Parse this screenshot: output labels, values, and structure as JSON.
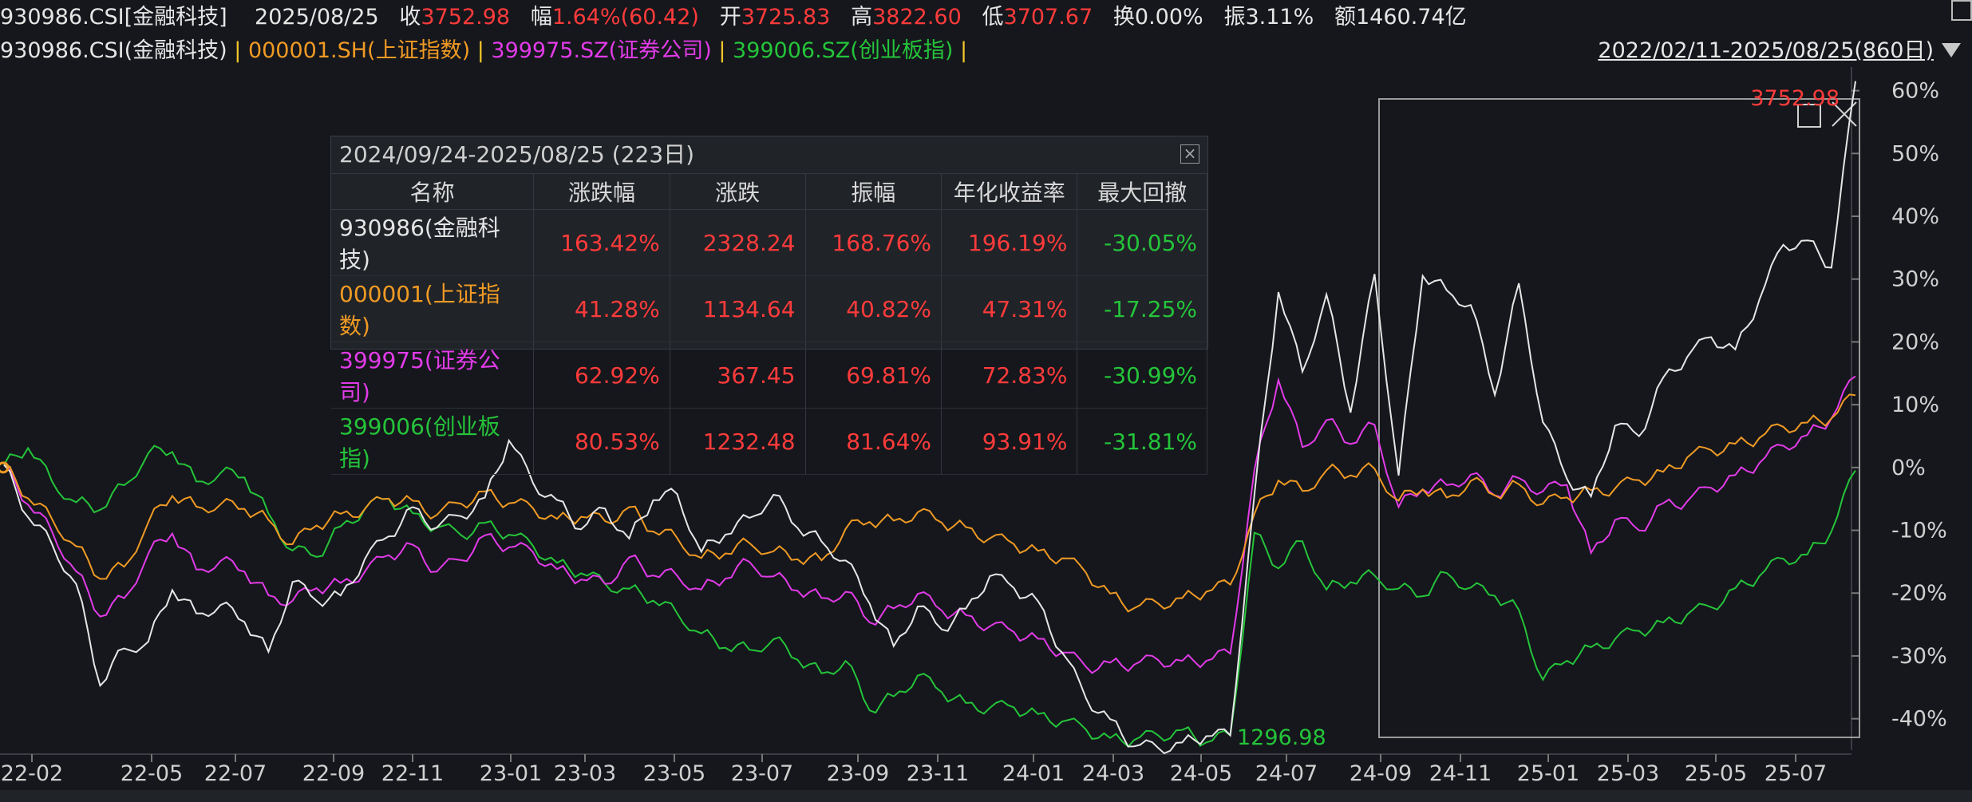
{
  "header": {
    "code": "930986.CSI[金融科技]",
    "date": "2025/08/25",
    "close_label": "收",
    "close": "3752.98",
    "change_label": "幅",
    "change": "1.64%(60.42)",
    "open_label": "开",
    "open": "3725.83",
    "high_label": "高",
    "high": "3822.60",
    "low_label": "低",
    "low": "3707.67",
    "turnover_label": "换",
    "turnover": "0.00%",
    "amplitude_label": "振",
    "amplitude": "3.11%",
    "amount_label": "额",
    "amount": "1460.74亿"
  },
  "legend": {
    "items": [
      {
        "label": "930986.CSI(金融科技)",
        "color": "#e6e6e6"
      },
      {
        "label": "000001.SH(上证指数)",
        "color": "#f09a24"
      },
      {
        "label": "399975.SZ(证券公司)",
        "color": "#e23be8"
      },
      {
        "label": "399006.SZ(创业板指)",
        "color": "#25c43a"
      }
    ],
    "range": "2022/02/11-2025/08/25(860日)"
  },
  "stats_panel": {
    "title": "2024/09/24-2025/08/25 (223日)",
    "columns": [
      "名称",
      "涨跌幅",
      "涨跌",
      "振幅",
      "年化收益率",
      "最大回撤"
    ],
    "rows": [
      {
        "name": "930986(金融科技)",
        "color": "#e6e6e6",
        "values": [
          "163.42%",
          "2328.24",
          "168.76%",
          "196.19%",
          "-30.05%"
        ]
      },
      {
        "name": "000001(上证指数)",
        "color": "#f09a24",
        "values": [
          "41.28%",
          "1134.64",
          "40.82%",
          "47.31%",
          "-17.25%"
        ]
      },
      {
        "name": "399975(证券公司)",
        "color": "#e23be8",
        "values": [
          "62.92%",
          "367.45",
          "69.81%",
          "72.83%",
          "-30.99%"
        ]
      },
      {
        "name": "399006(创业板指)",
        "color": "#25c43a",
        "values": [
          "80.53%",
          "1232.48",
          "81.64%",
          "93.91%",
          "-31.81%"
        ]
      }
    ]
  },
  "chart_data": {
    "type": "line",
    "xlabel": "",
    "ylabel": "",
    "ylim": [
      -45,
      63
    ],
    "y_ticks": [
      "60%",
      "50%",
      "40%",
      "30%",
      "20%",
      "10%",
      "0%",
      "-10%",
      "-20%",
      "-30%",
      "-40%"
    ],
    "x_ticks": [
      "22-02",
      "22-05",
      "22-07",
      "22-09",
      "22-11",
      "23-01",
      "23-03",
      "23-05",
      "23-07",
      "23-09",
      "23-11",
      "24-01",
      "24-03",
      "24-05",
      "24-07",
      "24-09",
      "24-11",
      "25-01",
      "25-03",
      "25-05",
      "25-07"
    ],
    "annotations": {
      "max_label": "3752.98",
      "min_label": "1296.98"
    },
    "grid": false,
    "series": [
      {
        "name": "930986.CSI(金融科技)",
        "color": "#e6e6e6",
        "values": [
          0,
          -8,
          -12,
          -18,
          -34,
          -28,
          -27,
          -19,
          -23,
          -22,
          -25,
          -30,
          -19,
          -22,
          -21,
          -15,
          -11,
          -6,
          -9,
          -7,
          -4,
          5,
          -2,
          -5,
          -10,
          -7,
          -12,
          -6,
          -5,
          -14,
          -11,
          -8,
          -4,
          -9,
          -11,
          -14,
          -21,
          -28,
          -22,
          -26,
          -23,
          -18,
          -20,
          -22,
          -30,
          -37,
          -40,
          -44,
          -44,
          -43,
          -42,
          -42,
          -4,
          28,
          15,
          27,
          8,
          30,
          -2,
          30,
          28,
          26,
          12,
          30,
          8,
          -1,
          -4,
          7,
          5,
          14,
          17,
          20,
          18,
          26,
          35,
          36,
          32,
          62
        ]
      },
      {
        "name": "000001.SH(上证指数)",
        "color": "#f09a24",
        "values": [
          0,
          -5,
          -8,
          -12,
          -17,
          -15,
          -8,
          -4,
          -6,
          -6,
          -7,
          -9,
          -13,
          -10,
          -8,
          -7,
          -5,
          -5,
          -7,
          -5,
          -3,
          -5,
          -6,
          -8,
          -8,
          -9,
          -7,
          -11,
          -12,
          -15,
          -14,
          -12,
          -13,
          -14,
          -14,
          -9,
          -8,
          -8,
          -7,
          -9,
          -10,
          -12,
          -13,
          -14,
          -15,
          -17,
          -20,
          -22,
          -21,
          -20,
          -19,
          -18,
          -7,
          -2,
          -4,
          -1,
          -2,
          -1,
          -6,
          -4,
          -5,
          -2,
          -4,
          -2,
          -5,
          -4,
          -3,
          -3,
          -2,
          -1,
          1,
          2,
          3,
          4,
          6,
          7,
          8,
          12
        ]
      },
      {
        "name": "399975.SZ(证券公司)",
        "color": "#e23be8",
        "values": [
          0,
          -6,
          -10,
          -16,
          -23,
          -20,
          -13,
          -10,
          -16,
          -15,
          -17,
          -21,
          -22,
          -20,
          -19,
          -17,
          -14,
          -12,
          -16,
          -14,
          -10,
          -12,
          -13,
          -16,
          -18,
          -19,
          -15,
          -18,
          -18,
          -20,
          -18,
          -15,
          -17,
          -19,
          -20,
          -19,
          -24,
          -22,
          -20,
          -23,
          -24,
          -26,
          -27,
          -28,
          -30,
          -32,
          -31,
          -31,
          -30,
          -30,
          -30,
          -29,
          0,
          14,
          3,
          7,
          3,
          6,
          -7,
          -4,
          -3,
          -1,
          -4,
          -1,
          -3,
          -2,
          -13,
          -8,
          -10,
          -6,
          -6,
          -4,
          -2,
          0,
          3,
          5,
          8,
          15
        ]
      },
      {
        "name": "399006.SZ(创业板指)",
        "color": "#25c43a",
        "values": [
          0,
          3,
          -2,
          -5,
          -6,
          -2,
          3,
          3,
          -2,
          -1,
          -2,
          -8,
          -14,
          -15,
          -10,
          -7,
          -5,
          -7,
          -9,
          -10,
          -8,
          -10,
          -12,
          -15,
          -17,
          -19,
          -20,
          -22,
          -24,
          -27,
          -29,
          -29,
          -27,
          -30,
          -32,
          -30,
          -38,
          -36,
          -33,
          -36,
          -38,
          -39,
          -39,
          -40,
          -41,
          -42,
          -43,
          -43,
          -42,
          -41,
          -43,
          -42,
          -10,
          -16,
          -12,
          -20,
          -19,
          -18,
          -20,
          -21,
          -17,
          -19,
          -20,
          -22,
          -33,
          -30,
          -28,
          -27,
          -26,
          -25,
          -24,
          -23,
          -20,
          -18,
          -15,
          -14,
          -10,
          0
        ]
      }
    ]
  }
}
